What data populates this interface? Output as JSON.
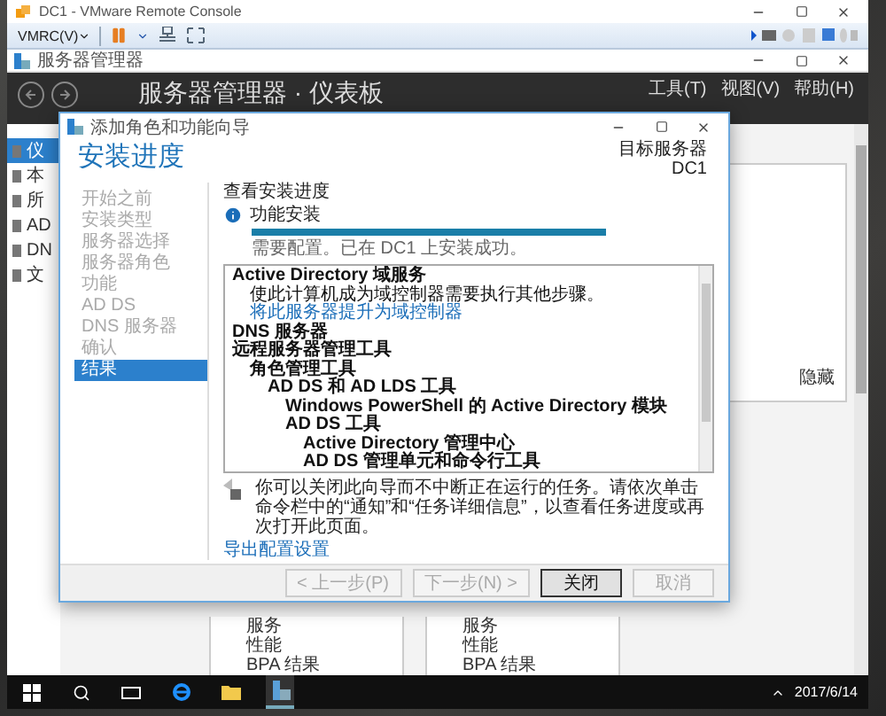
{
  "vmrc": {
    "title": "DC1 - VMware Remote Console",
    "menu": "VMRC(V)"
  },
  "server_manager": {
    "title": "服务器管理器",
    "header_title": "服务器管理器 · 仪表板",
    "menus": [
      "工具(T)",
      "视图(V)",
      "帮助(H)"
    ],
    "sidebar": [
      {
        "label": "仪",
        "selected": true
      },
      {
        "label": "本",
        "selected": false
      },
      {
        "label": "所",
        "selected": false
      },
      {
        "label": "AD",
        "selected": false
      },
      {
        "label": "DN",
        "selected": false
      },
      {
        "label": "文",
        "selected": false
      }
    ],
    "tile": {
      "link": "隐藏"
    },
    "panes": [
      {
        "items": [
          "服务",
          "性能",
          "BPA 结果"
        ]
      },
      {
        "items": [
          "服务",
          "性能",
          "BPA 结果"
        ]
      }
    ]
  },
  "wizard": {
    "title": "添加角色和功能向导",
    "heading": "安装进度",
    "target_label": "目标服务器",
    "target": "DC1",
    "steps": [
      {
        "label": "开始之前",
        "selected": false
      },
      {
        "label": "安装类型",
        "selected": false
      },
      {
        "label": "服务器选择",
        "selected": false
      },
      {
        "label": "服务器角色",
        "selected": false
      },
      {
        "label": "功能",
        "selected": false
      },
      {
        "label": "AD DS",
        "selected": false
      },
      {
        "label": "DNS 服务器",
        "selected": false
      },
      {
        "label": "确认",
        "selected": false
      },
      {
        "label": "结果",
        "selected": true
      }
    ],
    "section_title": "查看安装进度",
    "status": "功能安装",
    "progress": {
      "level": 1
    },
    "status_message": "需要配置。已在 DC1 上安装成功。",
    "results": [
      {
        "text": "Active Directory 域服务",
        "kind": "heading",
        "children": [
          {
            "text": "使此计算机成为域控制器需要执行其他步骤。",
            "kind": "note"
          },
          {
            "text": "将此服务器提升为域控制器",
            "kind": "link"
          }
        ]
      },
      {
        "text": "DNS 服务器",
        "kind": "heading"
      },
      {
        "text": "远程服务器管理工具",
        "kind": "heading",
        "children": [
          {
            "text": "角色管理工具",
            "kind": "heading",
            "children": [
              {
                "text": "AD DS 和 AD LDS 工具",
                "kind": "heading",
                "children": [
                  {
                    "text": "Windows PowerShell 的 Active Directory 模块",
                    "kind": "heading"
                  },
                  {
                    "text": "AD DS 工具",
                    "kind": "heading",
                    "children": [
                      {
                        "text": "Active Directory 管理中心",
                        "kind": "heading"
                      },
                      {
                        "text": "AD DS 管理单元和命令行工具",
                        "kind": "heading"
                      }
                    ]
                  }
                ]
              }
            ]
          }
        ]
      }
    ],
    "tip": "你可以关闭此向导而不中断正在运行的任务。请依次单击命令栏中的“通知”和“任务详细信息”，以查看任务进度或再次打开此页面。",
    "export_link": "导出配置设置",
    "buttons": [
      {
        "label": "< 上一步(P)",
        "disabled": true,
        "default": false
      },
      {
        "label": "下一步(N) >",
        "disabled": true,
        "default": false
      },
      {
        "label": "关闭",
        "disabled": false,
        "default": true
      },
      {
        "label": "取消",
        "disabled": true,
        "default": false
      }
    ]
  },
  "taskbar": {
    "date": "2017/6/14"
  }
}
